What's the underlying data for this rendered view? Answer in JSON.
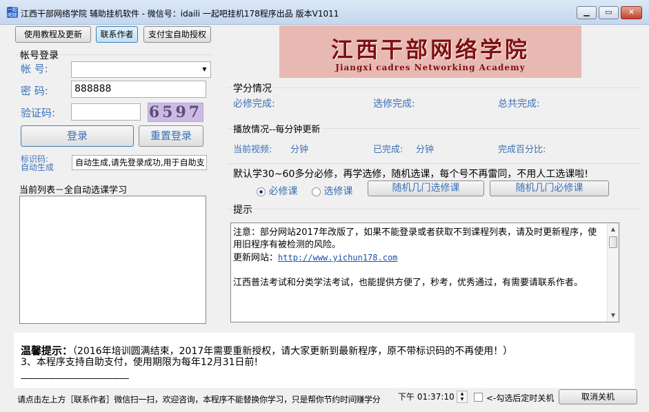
{
  "window": {
    "title": "江西干部网络学院 辅助挂机软件 -  微信号：idaili  一起吧挂机178程序出品 版本V1011",
    "icon_text": "一起吧挂机",
    "minimize_icon": "minimize-icon",
    "maximize_icon": "maximize-icon",
    "close_icon": "close-icon"
  },
  "toolbar": {
    "tutorial_label": "使用教程及更新",
    "contact_label": "联系作者",
    "alipay_label": "支付宝自助授权"
  },
  "banner": {
    "title_cn": "江西干部网络学院",
    "title_en": "Jiangxi cadres Networking Academy"
  },
  "login": {
    "group_title": "帐号登录",
    "account_label": "帐  号:",
    "account_value": "",
    "password_label": "密  码:",
    "password_value": "888888",
    "captcha_label": "验证码:",
    "captcha_value": "",
    "captcha_image_text": "6597",
    "login_button": "登录",
    "relogin_button": "重置登录",
    "id_label_line1": "标识码:",
    "id_label_line2": "自动生成",
    "id_value": "自动生成,请先登录成功,用于自助支"
  },
  "list": {
    "title": "当前列表－全自动选课学习"
  },
  "credits": {
    "group_title": "学分情况",
    "required_label": "必修完成:",
    "elective_label": "选修完成:",
    "total_label": "总共完成:"
  },
  "playback": {
    "group_title": "播放情况--每分钟更新",
    "current_video_label": "当前视频:",
    "current_video_unit": "分钟",
    "completed_label": "已完成:",
    "completed_unit": "分钟",
    "percent_label": "完成百分比:"
  },
  "selection": {
    "notice": "默认学30~60多分必修，再学选修，随机选课，每个号不再雷同，不用人工选课啦!",
    "radio_required": "必修课",
    "radio_elective": "选修课",
    "random_elective_button": "随机几门选修课",
    "random_required_button": "随机几门必修课"
  },
  "tips": {
    "group_title": "提示",
    "line1": "注意：部分网站2017年改版了，如果不能登录或者获取不到课程列表，请及时更新程序，使用旧程序有被检测的风险。",
    "update_label": "更新网站：",
    "update_url": "http://www.yichun178.com",
    "line2": "江西普法考试和分类学法考试，也能提供方便了，秒考，优秀通过，有需要请联系作者。"
  },
  "bottom": {
    "warm_tip_label": "温馨提示：",
    "warm_tip_text": "（2016年培训圆满结束，2017年需要重新授权，请大家更新到最新程序，原不带标识码的不再使用！）",
    "line2": "3、本程序支持自助支付，使用期限为每年12月31日前!",
    "divider": "-----------------------------------------------"
  },
  "status_bar": {
    "message": "请点击左上方［联系作者］微信扫一扫，欢迎咨询，本程序不能替换你学习，只是帮你节约时间赚学分",
    "time_value": "下午 01:37:10",
    "shutdown_checkbox_label": "<-勾选后定时关机",
    "cancel_shutdown_button": "取消关机"
  },
  "colors": {
    "accent_blue": "#3a71b6",
    "banner_bg": "#e8b9b2",
    "banner_text": "#7d1010"
  }
}
